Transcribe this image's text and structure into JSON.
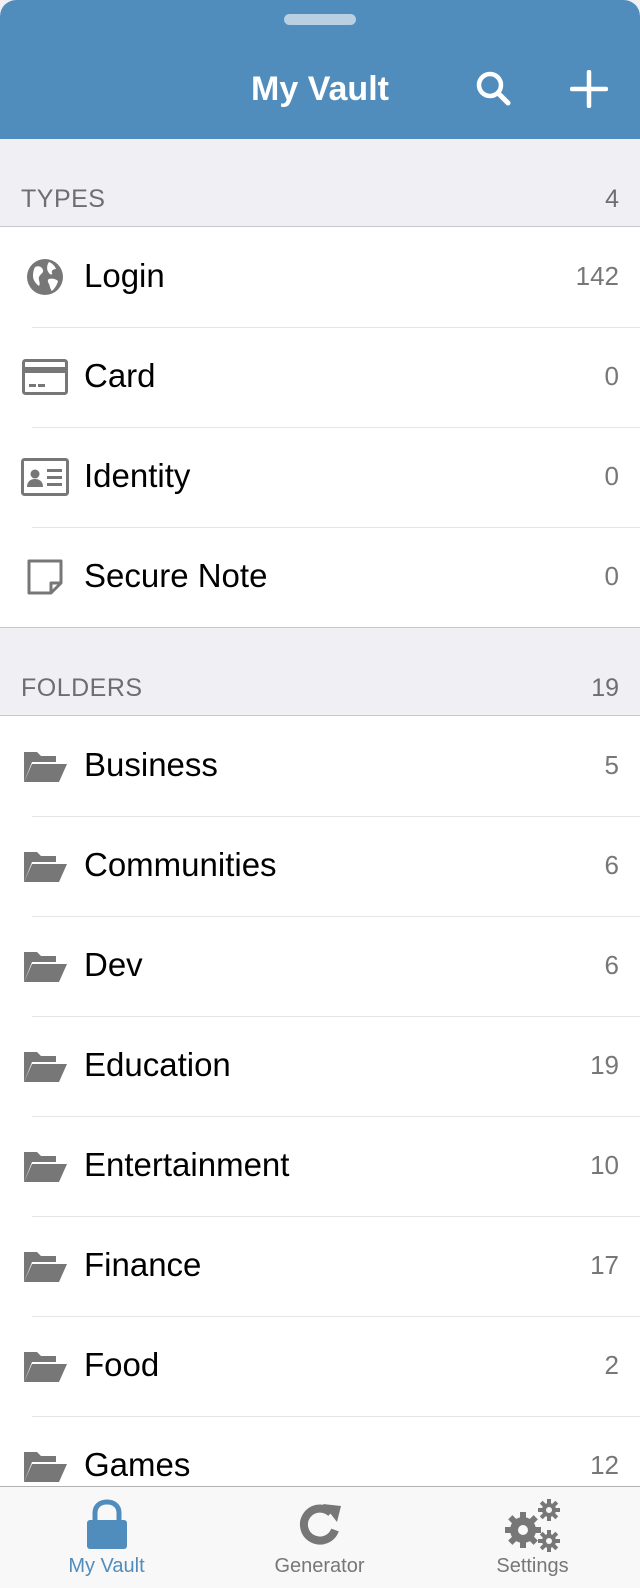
{
  "header": {
    "title": "My Vault",
    "search_icon": "search-icon",
    "add_icon": "plus-icon"
  },
  "types": {
    "title": "TYPES",
    "count": "4",
    "items": [
      {
        "label": "Login",
        "count": "142",
        "icon": "globe-icon"
      },
      {
        "label": "Card",
        "count": "0",
        "icon": "credit-card-icon"
      },
      {
        "label": "Identity",
        "count": "0",
        "icon": "id-card-icon"
      },
      {
        "label": "Secure Note",
        "count": "0",
        "icon": "note-icon"
      }
    ]
  },
  "folders": {
    "title": "FOLDERS",
    "count": "19",
    "items": [
      {
        "label": "Business",
        "count": "5",
        "icon": "folder-open-icon"
      },
      {
        "label": "Communities",
        "count": "6",
        "icon": "folder-open-icon"
      },
      {
        "label": "Dev",
        "count": "6",
        "icon": "folder-open-icon"
      },
      {
        "label": "Education",
        "count": "19",
        "icon": "folder-open-icon"
      },
      {
        "label": "Entertainment",
        "count": "10",
        "icon": "folder-open-icon"
      },
      {
        "label": "Finance",
        "count": "17",
        "icon": "folder-open-icon"
      },
      {
        "label": "Food",
        "count": "2",
        "icon": "folder-open-icon"
      },
      {
        "label": "Games",
        "count": "12",
        "icon": "folder-open-icon"
      }
    ]
  },
  "tabbar": {
    "tabs": [
      {
        "label": "My Vault",
        "icon": "lock-icon",
        "active": true
      },
      {
        "label": "Generator",
        "icon": "refresh-icon",
        "active": false
      },
      {
        "label": "Settings",
        "icon": "gears-icon",
        "active": false
      }
    ]
  },
  "colors": {
    "brand": "#518dbc",
    "icon_gray": "#777777",
    "section_bg": "#efeff4"
  }
}
